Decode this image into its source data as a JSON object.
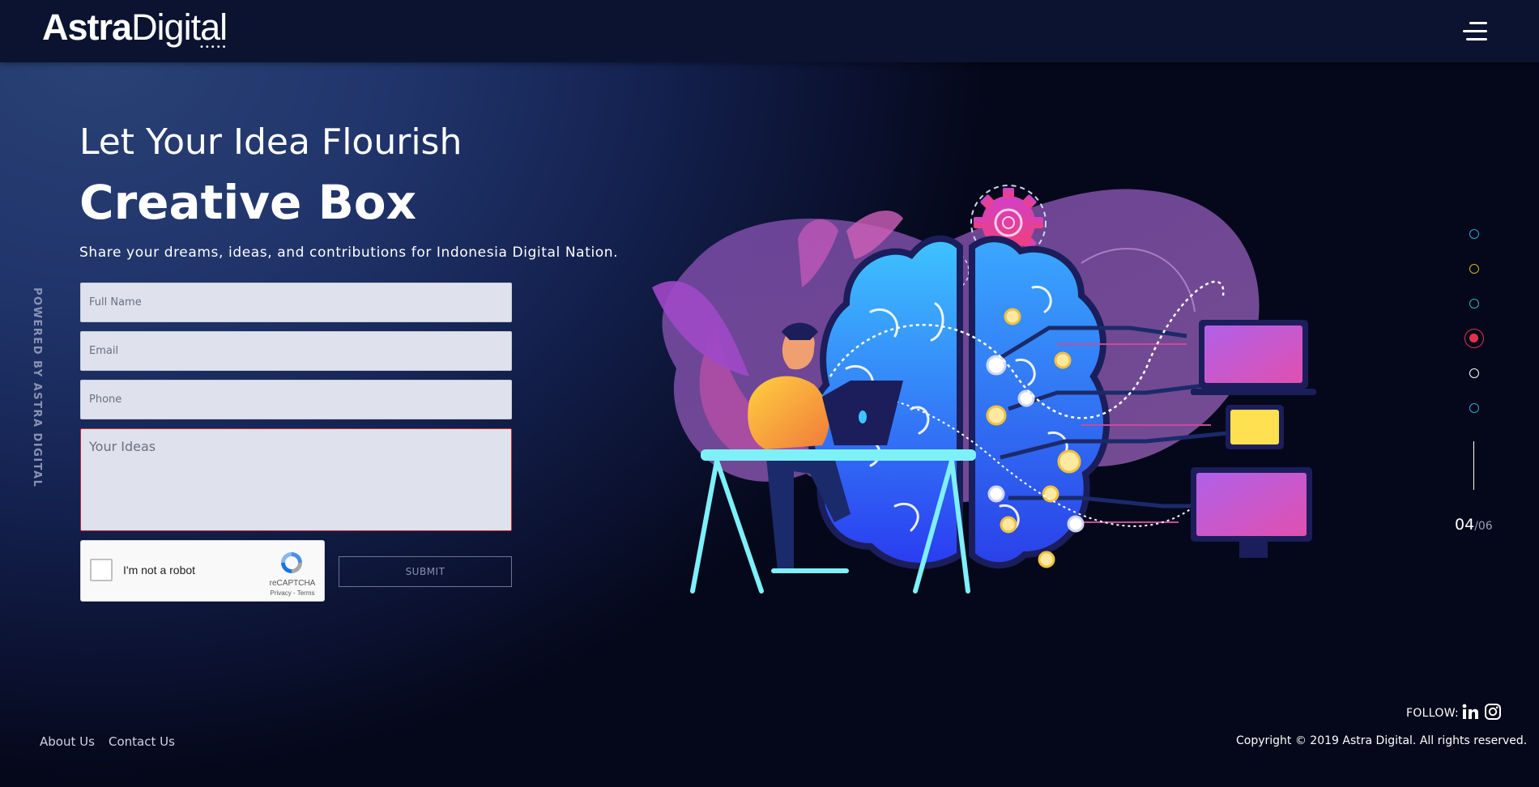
{
  "header": {
    "logo_bold": "Astra",
    "logo_light": "Digital",
    "logo_dots": "•••••",
    "menu_icon": "hamburger-menu-icon"
  },
  "side_text": "POWERED BY ASTRA DIGITAL",
  "hero": {
    "subtitle": "Let Your Idea Flourish",
    "title": "Creative Box",
    "description": "Share your dreams, ideas, and contributions for Indonesia Digital Nation."
  },
  "form": {
    "full_name_placeholder": "Full Name",
    "email_placeholder": "Email",
    "phone_placeholder": "Phone",
    "ideas_placeholder": "Your Ideas",
    "captcha_label": "I'm not a robot",
    "captcha_brand": "reCAPTCHA",
    "captcha_links": "Privacy - Terms",
    "submit_label": "SUBMIT"
  },
  "pager": {
    "current": "04",
    "total": "/06",
    "dot_colors": [
      "#2aa8d8",
      "#d8b02a",
      "#2ab8b0",
      "#e0334f",
      "#ffffff",
      "#2aa8d8"
    ],
    "active_index": 3
  },
  "footer": {
    "about": "About Us",
    "contact": "Contact Us",
    "follow": "FOLLOW:",
    "social_icons": [
      "linkedin-icon",
      "instagram-icon"
    ],
    "copyright": "Copyright © 2019 Astra Digital. All rights reserved."
  }
}
